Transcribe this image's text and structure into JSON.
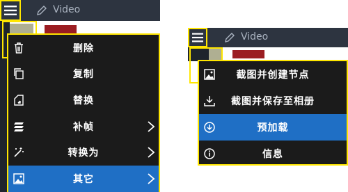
{
  "topbar": {
    "title": "Video"
  },
  "menu1": {
    "items": [
      {
        "label": "删除",
        "icon": "trash-icon",
        "submenu": false,
        "selected": false
      },
      {
        "label": "复制",
        "icon": "copy-icon",
        "submenu": false,
        "selected": false
      },
      {
        "label": "替换",
        "icon": "replace-icon",
        "submenu": false,
        "selected": false
      },
      {
        "label": "补帧",
        "icon": "layers-icon",
        "submenu": true,
        "selected": false
      },
      {
        "label": "转换为",
        "icon": "magic-wand-icon",
        "submenu": true,
        "selected": false
      },
      {
        "label": "其它",
        "icon": "image-icon",
        "submenu": true,
        "selected": true
      }
    ]
  },
  "menu2": {
    "title": "Video",
    "items": [
      {
        "label": "截图并创建节点",
        "icon": "image-icon",
        "selected": false
      },
      {
        "label": "截图并保存至相册",
        "icon": "download-icon",
        "selected": false
      },
      {
        "label": "预加载",
        "icon": "circle-download-icon",
        "selected": true
      },
      {
        "label": "信息",
        "icon": "info-icon",
        "selected": false
      }
    ]
  },
  "colors": {
    "highlight": "#ffe600",
    "selected": "#1f6fc5",
    "menu_bg": "#1b1b1b",
    "topbar": "#2d3440"
  }
}
